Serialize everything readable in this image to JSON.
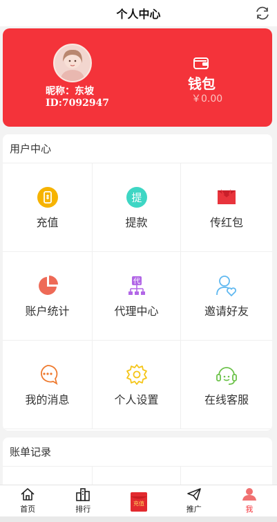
{
  "header": {
    "title": "个人中心",
    "refresh_icon": "refresh-icon"
  },
  "profile": {
    "nickname": "昵称：东坡",
    "id_text": "ID:7092947",
    "avatar_icon": "user-avatar",
    "wallet_icon": "wallet-icon",
    "wallet_label": "钱包",
    "wallet_amount": "￥0.00"
  },
  "user_center": {
    "title": "用户中心",
    "items": [
      {
        "label": "充值",
        "icon": "phone-recharge-icon",
        "color": "#f6b300"
      },
      {
        "label": "提款",
        "icon": "withdraw-icon",
        "icon_text": "提",
        "color": "#3ed6c4"
      },
      {
        "label": "传红包",
        "icon": "red-envelope-icon",
        "color": "#e8343c"
      },
      {
        "label": "账户统计",
        "icon": "pie-chart-icon",
        "color": "#ee6a57"
      },
      {
        "label": "代理中心",
        "icon": "agent-icon",
        "icon_text": "代",
        "color": "#b267e6"
      },
      {
        "label": "邀请好友",
        "icon": "invite-friend-icon",
        "color": "#5fb8f0"
      },
      {
        "label": "我的消息",
        "icon": "message-icon",
        "color": "#ee7a2f"
      },
      {
        "label": "个人设置",
        "icon": "settings-gear-icon",
        "color": "#f5c518"
      },
      {
        "label": "在线客服",
        "icon": "headset-icon",
        "color": "#6cc24a"
      }
    ]
  },
  "bill_records": {
    "title": "账单记录"
  },
  "tabbar": {
    "items": [
      {
        "label": "首页",
        "icon": "home-icon"
      },
      {
        "label": "排行",
        "icon": "ranking-icon"
      },
      {
        "label": "",
        "icon": "recharge-envelope-icon",
        "icon_text": "充值"
      },
      {
        "label": "推广",
        "icon": "send-icon"
      },
      {
        "label": "我",
        "icon": "profile-icon"
      }
    ],
    "active_index": 4,
    "active_color": "#f4333a"
  },
  "theme": {
    "accent": "#f4333a"
  }
}
